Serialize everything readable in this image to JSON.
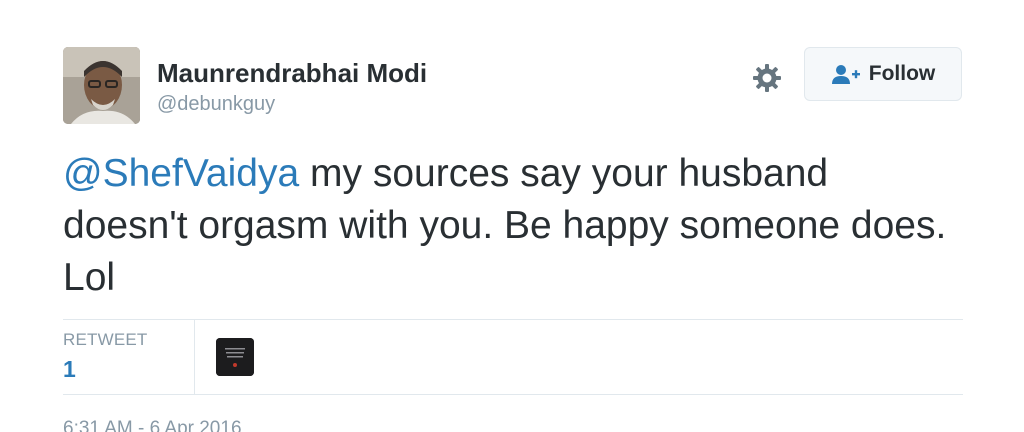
{
  "user": {
    "display_name": "Maunrendrabhai Modi",
    "handle": "@debunkguy"
  },
  "actions": {
    "follow_label": "Follow"
  },
  "tweet": {
    "mention": "@ShefVaidya",
    "text": " my sources say your husband doesn't orgasm with you. Be happy someone does. Lol"
  },
  "stats": {
    "retweet_label": "RETWEET",
    "retweet_count": "1"
  },
  "meta": {
    "timestamp": "6:31 AM - 6 Apr 2016"
  },
  "colors": {
    "link": "#2b7bb9",
    "text": "#292f33",
    "muted": "#8899a6",
    "border": "#e1e8ed"
  }
}
